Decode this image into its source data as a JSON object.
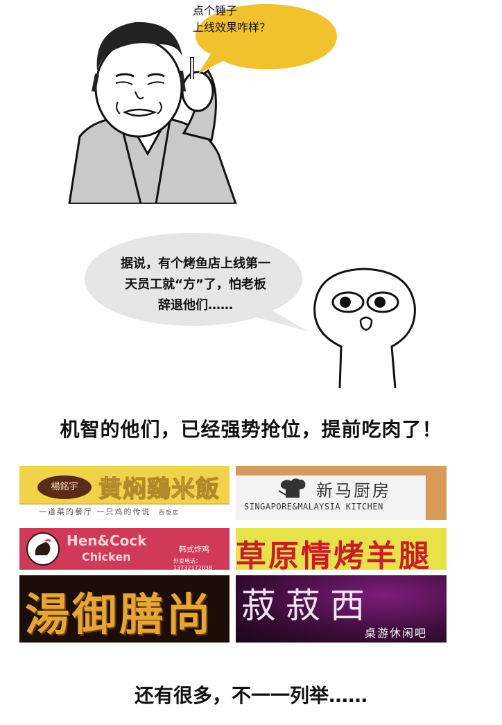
{
  "scene1": {
    "speech": [
      "点个锤子",
      "上线效果咋样？"
    ],
    "bubble_color": "#f2c12e"
  },
  "scene2": {
    "speech": [
      "据说，有个烤鱼店上线第一",
      "天员工就“方”了，怕老板",
      "辞退他们……"
    ],
    "bubble_color": "#e6e6e6"
  },
  "headline": "机智的他们，已经强势抢位，提前吃肉了！",
  "signs": [
    {
      "brand": "楊銘宇",
      "title": "黄焖鷄米飯",
      "subtitle": "一道菜的餐厅  一只鸡的传说",
      "branch": "西塑店"
    },
    {
      "title": "新马厨房",
      "subtitle": "SINGAPORE&MALAYSIA KITCHEN"
    },
    {
      "title": "Hen&Cock",
      "title2": "Chicken",
      "subtitle": "韩式炸鸡",
      "phone": "外卖电话：13732172038"
    },
    {
      "title": "草原情烤羊腿"
    },
    {
      "title": "湯御膳尚"
    },
    {
      "title": "菽菽西",
      "subtitle": "桌游休闲吧"
    }
  ],
  "footer": "还有很多，不一一列举……"
}
